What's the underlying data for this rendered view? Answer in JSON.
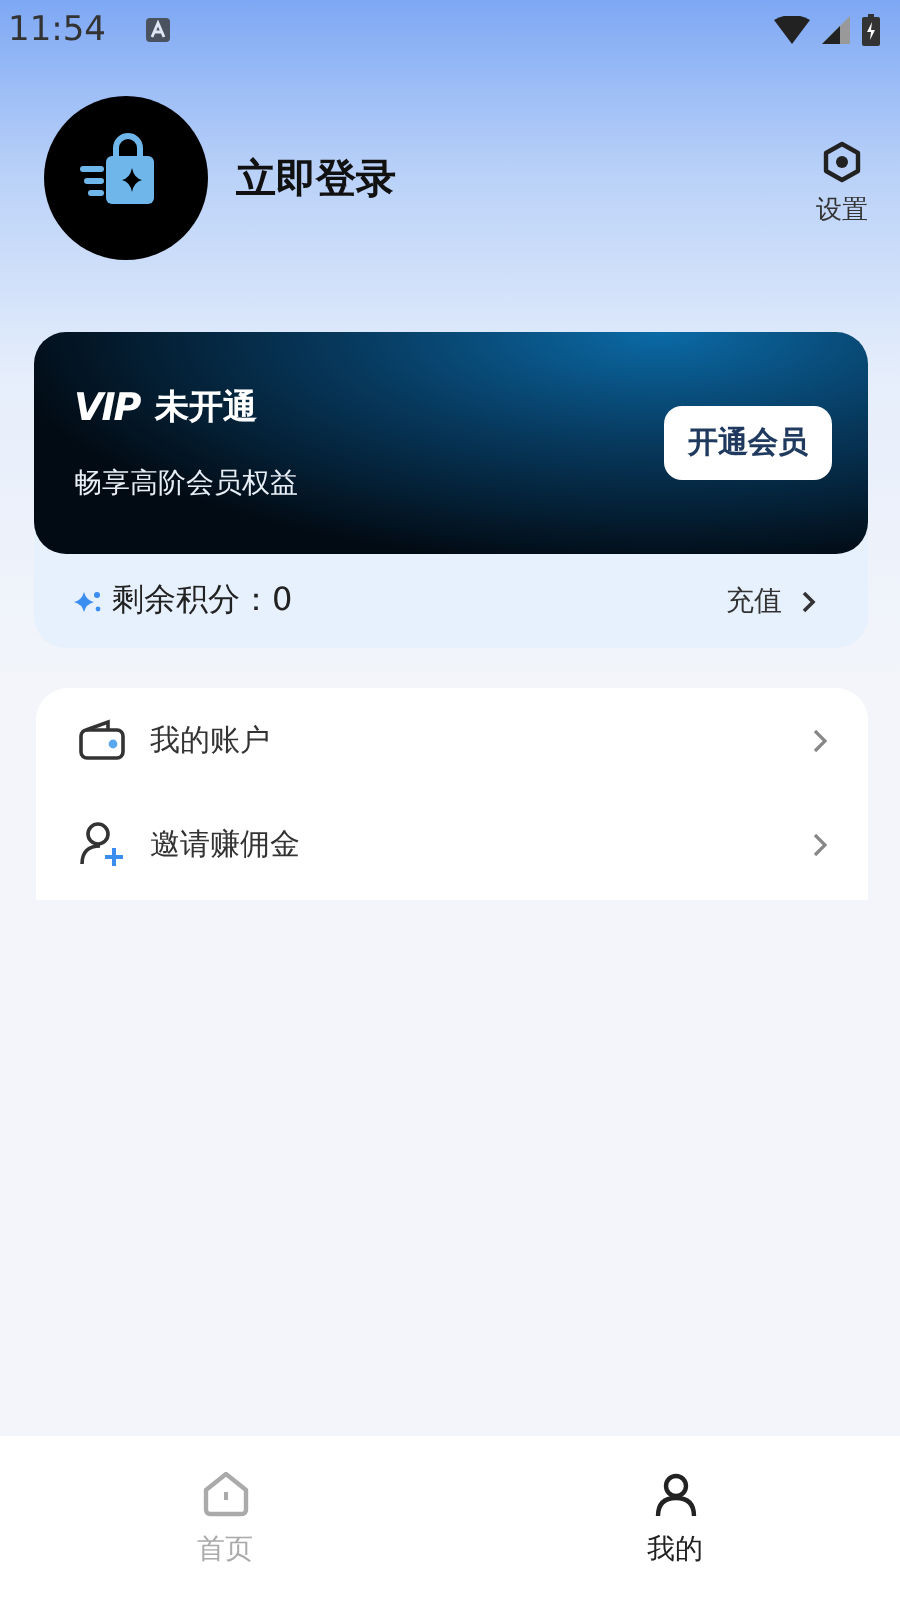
{
  "status_bar": {
    "time": "11:54"
  },
  "profile": {
    "login_label": "立即登录",
    "settings_label": "设置"
  },
  "vip_card": {
    "badge": "VIP",
    "status": "未开通",
    "subtitle": "畅享高阶会员权益",
    "button": "开通会员"
  },
  "points": {
    "label": "剩余积分：0",
    "action": "充值"
  },
  "menu": [
    {
      "kind": "wallet",
      "label": "我的账户"
    },
    {
      "kind": "invite",
      "label": "邀请赚佣金"
    }
  ],
  "tabs": [
    {
      "kind": "home",
      "label": "首页",
      "selected": false
    },
    {
      "kind": "me",
      "label": "我的",
      "selected": true
    }
  ]
}
